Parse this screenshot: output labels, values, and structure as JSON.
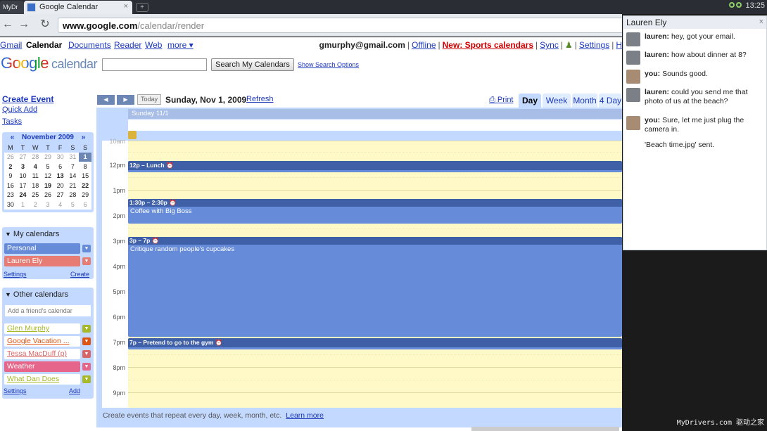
{
  "browser": {
    "tab_a_label": "MyDr",
    "tab_label": "Google Calendar",
    "tab_close": "×",
    "new_tab": "+",
    "clock": "13:25",
    "url_domain": "www.google.com",
    "url_path": "/calendar/render"
  },
  "gbar": {
    "links": [
      "Gmail",
      "Calendar",
      "Documents",
      "Reader",
      "Web",
      "more ▾"
    ],
    "user": "gmurphy@gmail.com",
    "offline": "Offline",
    "new_sports": "New: Sports calendars",
    "sync": "Sync",
    "settings": "Settings",
    "h": "H"
  },
  "search": {
    "logo_google": "Google",
    "logo_calendar": "calendar",
    "button": "Search My Calendars",
    "options": "Show Search Options"
  },
  "left": {
    "create_event": "Create Event",
    "quick_add": "Quick Add",
    "tasks": "Tasks"
  },
  "minical": {
    "prev": "«",
    "next": "»",
    "month": "November 2009",
    "weekdays": [
      "M",
      "T",
      "W",
      "T",
      "F",
      "S",
      "S"
    ],
    "weeks": [
      [
        "26",
        "27",
        "28",
        "29",
        "30",
        "31",
        "1"
      ],
      [
        "2",
        "3",
        "4",
        "5",
        "6",
        "7",
        "8"
      ],
      [
        "9",
        "10",
        "11",
        "12",
        "13",
        "14",
        "15"
      ],
      [
        "16",
        "17",
        "18",
        "19",
        "20",
        "21",
        "22"
      ],
      [
        "23",
        "24",
        "25",
        "26",
        "27",
        "28",
        "29"
      ],
      [
        "30",
        "1",
        "2",
        "3",
        "4",
        "5",
        "6"
      ]
    ]
  },
  "my_calendars": {
    "title": "My calendars",
    "items": [
      "Personal",
      "Lauren Ely"
    ],
    "settings": "Settings",
    "create": "Create"
  },
  "other_calendars": {
    "title": "Other calendars",
    "placeholder": "Add a friend's calendar",
    "items": [
      "Glen Murphy",
      "Google Vacation ...",
      "Tessa MacDuff (p)",
      "Weather",
      "What Dan Does"
    ],
    "settings": "Settings",
    "add": "Add"
  },
  "calendar": {
    "today": "Today",
    "date_title": "Sunday, Nov 1, 2009",
    "refresh": "Refresh",
    "print": "Print",
    "views": [
      "Day",
      "Week",
      "Month",
      "4 Day"
    ],
    "day_header": "Sunday 11/1",
    "time_labels": [
      "10am",
      "12pm",
      "1pm",
      "2pm",
      "3pm",
      "4pm",
      "5pm",
      "6pm",
      "7pm",
      "8pm",
      "9pm"
    ],
    "events": [
      {
        "time": "12p – Lunch",
        "title": ""
      },
      {
        "time": "1:30p – 2:30p",
        "title": "Coffee with Big Boss"
      },
      {
        "time": "3p – 7p",
        "title": "Critique random people's cupcakes"
      },
      {
        "time": "7p – Pretend to go to the gym",
        "title": ""
      }
    ],
    "tip": "Create events that repeat every day, week, month, etc.",
    "learn_more": "Learn more"
  },
  "chat": {
    "title": "Lauren Ely",
    "close": "×",
    "messages": [
      {
        "who": "lauren:",
        "text": "hey, got your email."
      },
      {
        "who": "lauren:",
        "text": "how about dinner at 8?"
      },
      {
        "who": "you:",
        "text": "Sounds good."
      },
      {
        "who": "lauren:",
        "text": "could you send me that photo of us at the beach?"
      },
      {
        "who": "you:",
        "text": "Sure, let me just plug the camera in."
      }
    ],
    "system": "'Beach time.jpg' sent."
  },
  "watermark": "MyDrivers.com 驱动之家",
  "colors": {
    "calendar_blue": "#c3d9ff",
    "event_blue": "#668cd9",
    "day_yellow": "#fff8c7",
    "personal": "#668cd9",
    "lauren": "#e67c73",
    "glen": "#a7b828",
    "vacation": "#dd5511",
    "tessa": "#d96666",
    "weather": "#e6658a",
    "dan": "#a7b828"
  }
}
